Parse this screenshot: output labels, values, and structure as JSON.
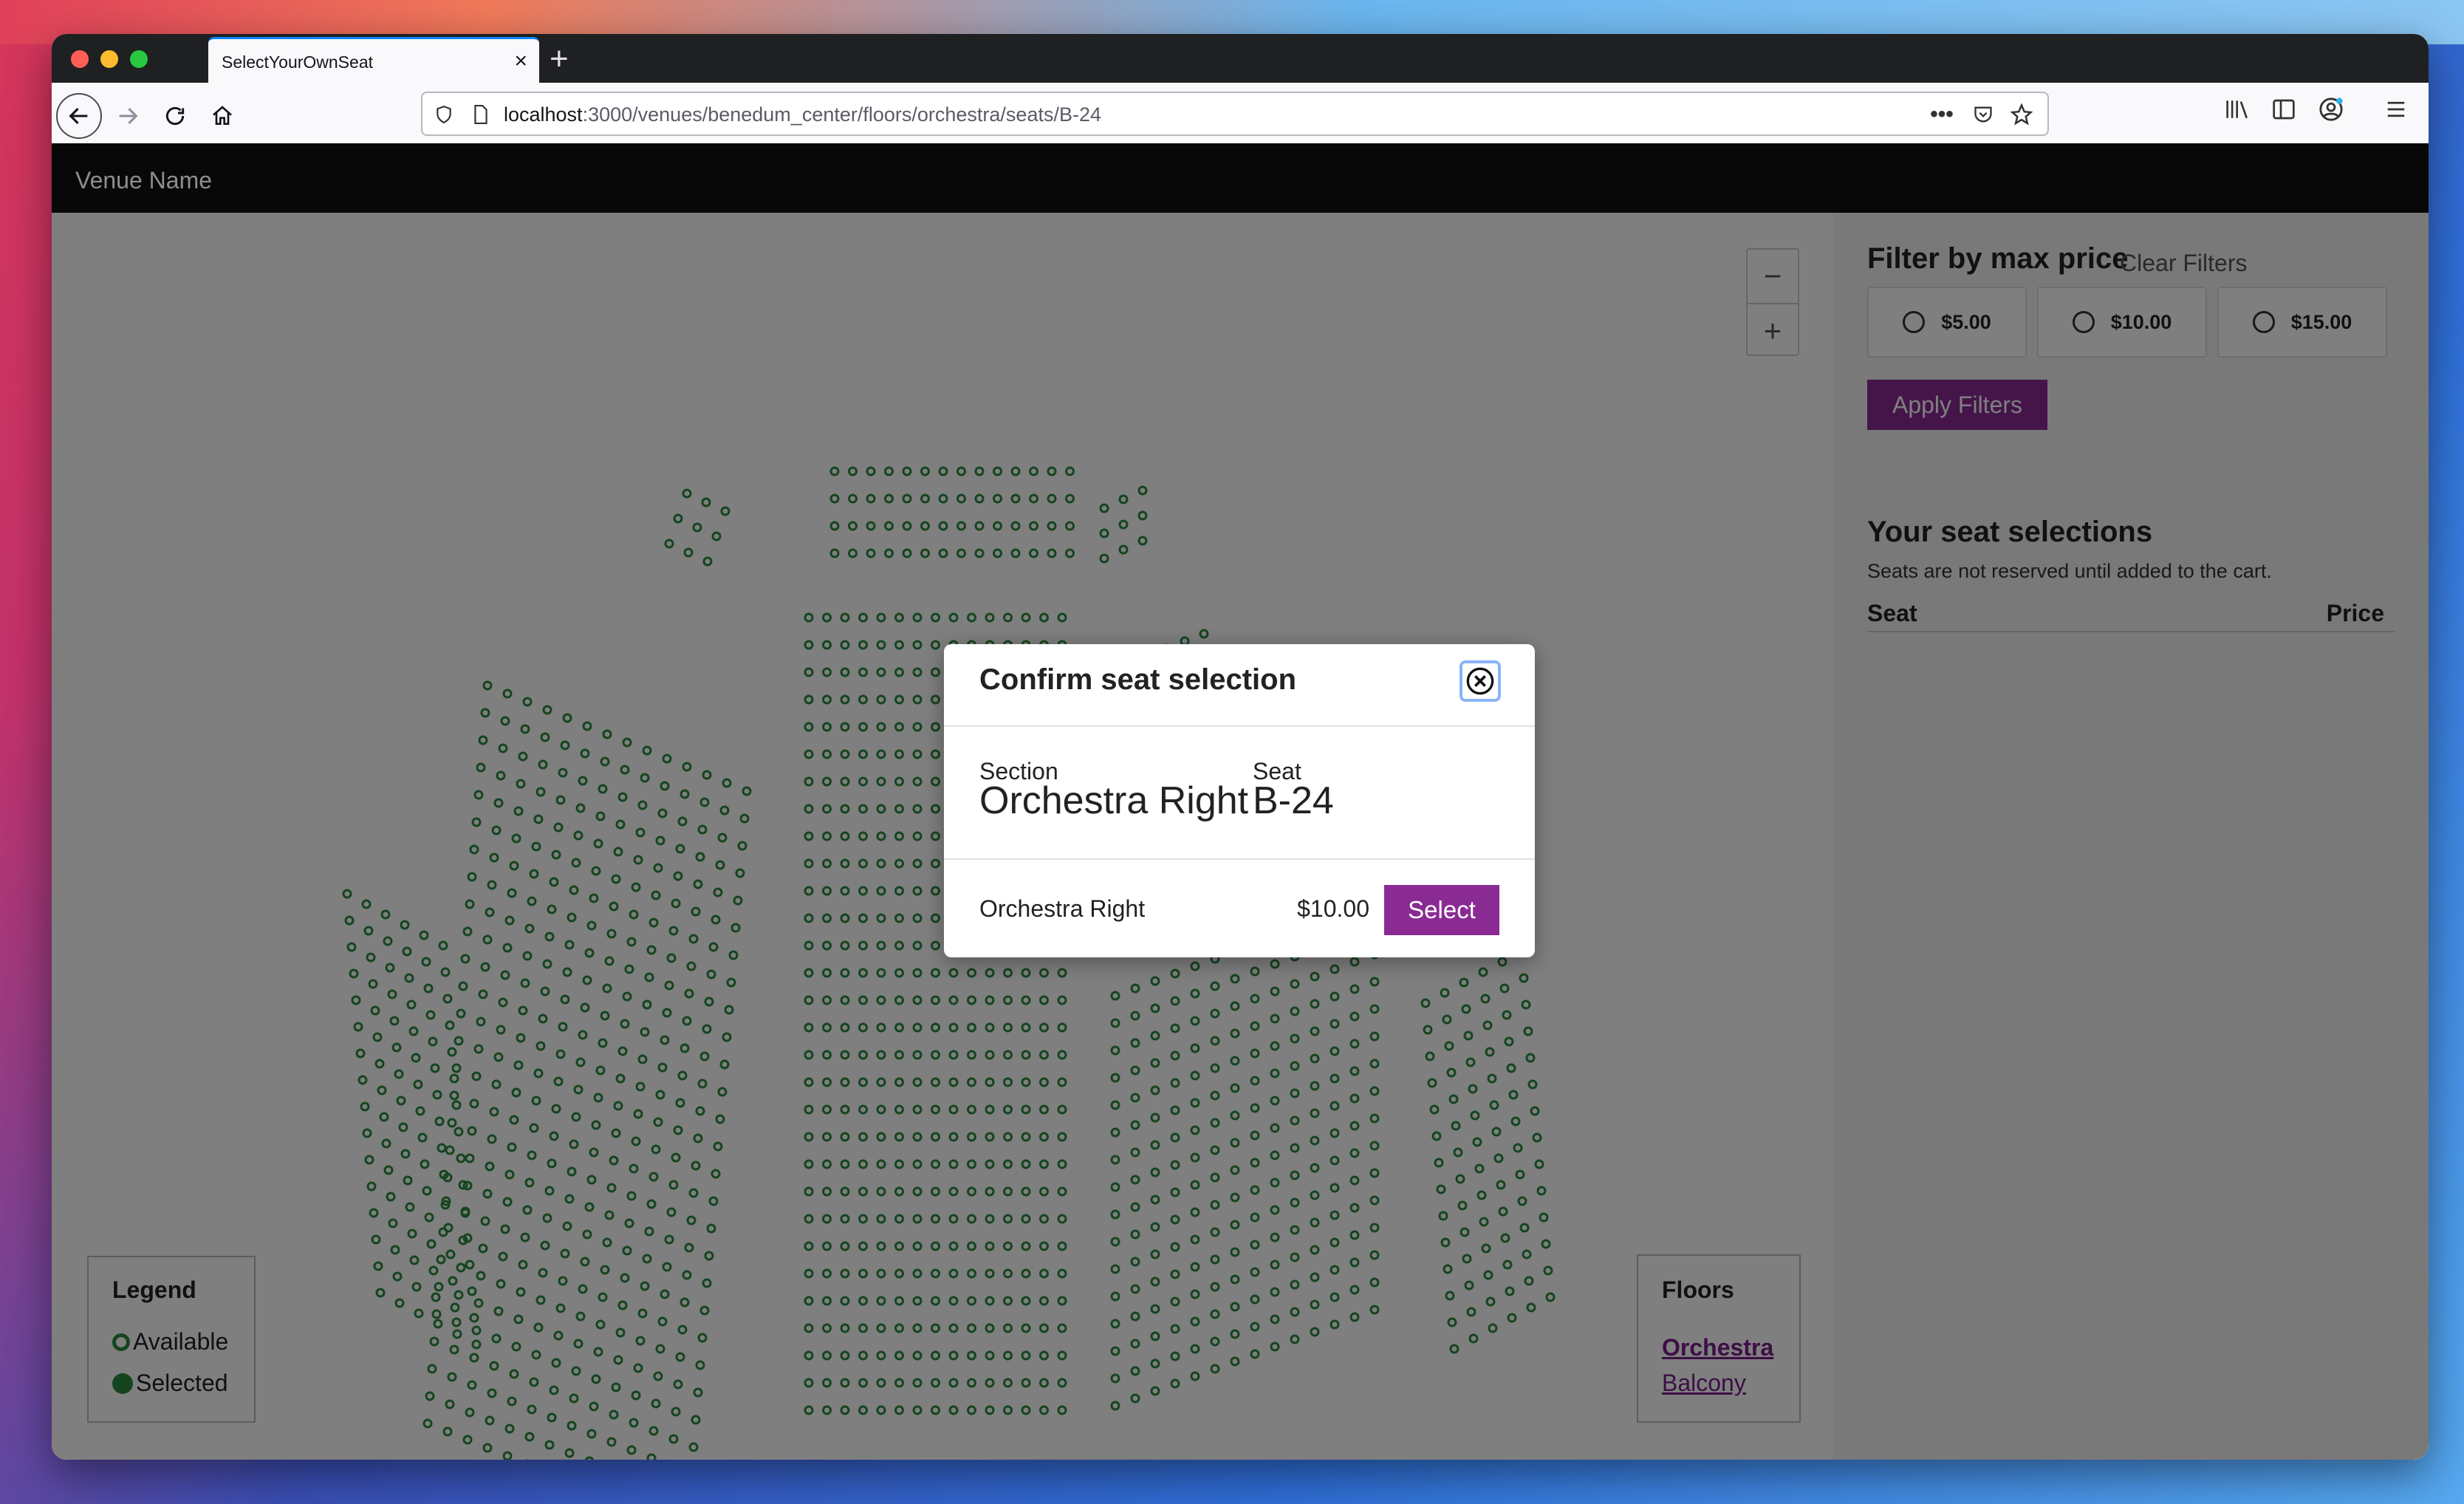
{
  "browser": {
    "tab_title": "SelectYourOwnSeat",
    "url_host": "localhost",
    "url_path": ":3000/venues/benedum_center/floors/orchestra/seats/B-24"
  },
  "app": {
    "brand": "Venue Name"
  },
  "map": {
    "seat_color": "#2a8a3e",
    "zoom_out_label": "−",
    "zoom_in_label": "+"
  },
  "legend": {
    "title": "Legend",
    "available_label": "Available",
    "selected_label": "Selected"
  },
  "floors": {
    "title": "Floors",
    "items": [
      "Orchestra",
      "Balcony"
    ],
    "active": "Orchestra"
  },
  "filter": {
    "title": "Filter by max price",
    "clear_label": "Clear Filters",
    "options": [
      "$5.00",
      "$10.00",
      "$15.00"
    ],
    "apply_label": "Apply Filters"
  },
  "selections": {
    "title": "Your seat selections",
    "note": "Seats are not reserved until added to the cart.",
    "col_seat": "Seat",
    "col_price": "Price"
  },
  "modal": {
    "title": "Confirm seat selection",
    "section_label": "Section",
    "section_value": "Orchestra Right",
    "seat_label": "Seat",
    "seat_value": "B-24",
    "offer_name": "Orchestra Right",
    "offer_price": "$10.00",
    "select_label": "Select"
  },
  "colors": {
    "accent": "#8a2b94",
    "header": "#080808"
  }
}
